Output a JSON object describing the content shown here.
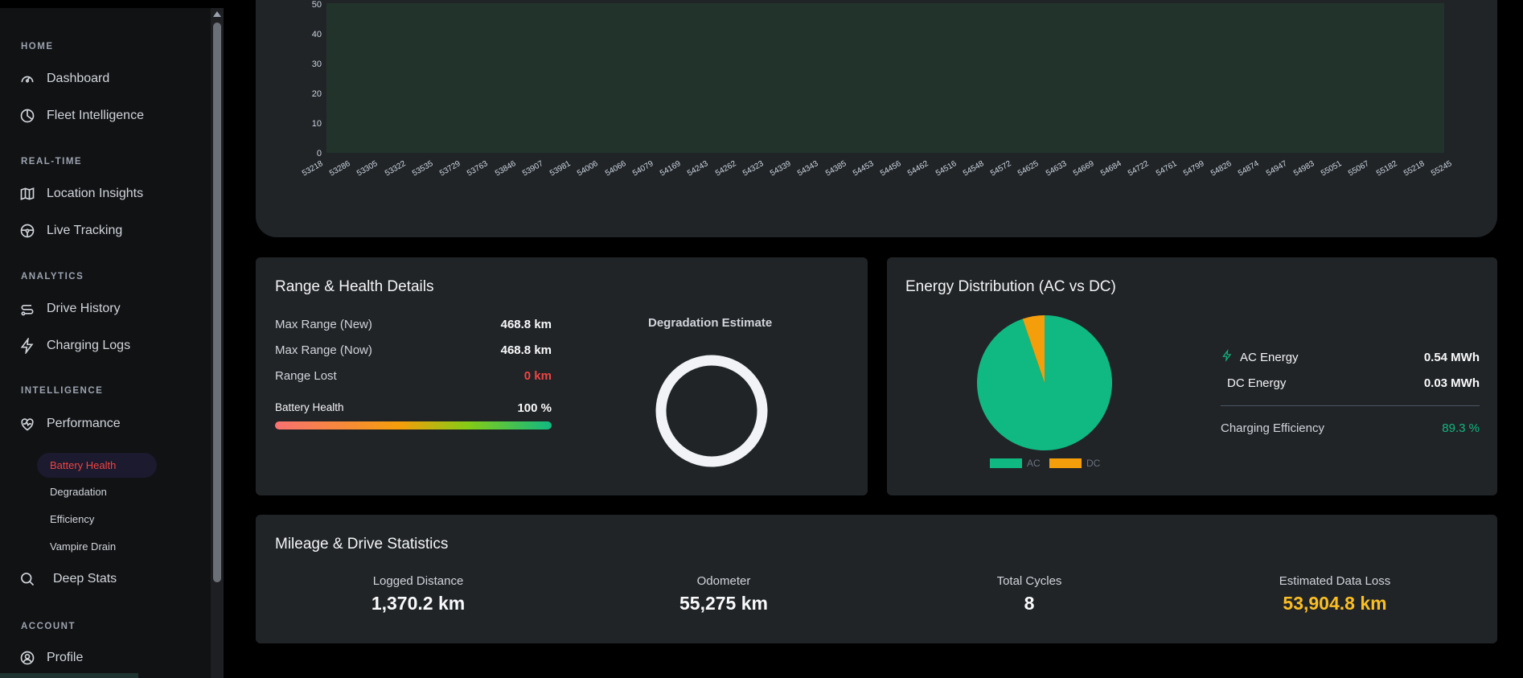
{
  "sidebar": {
    "sections": {
      "home": "HOME",
      "realtime": "REAL-TIME",
      "analytics": "ANALYTICS",
      "intelligence": "INTELLIGENCE",
      "account": "ACCOUNT"
    },
    "items": {
      "dashboard": "Dashboard",
      "fleet": "Fleet Intelligence",
      "location": "Location Insights",
      "live": "Live Tracking",
      "drive": "Drive History",
      "charging": "Charging Logs",
      "performance": "Performance",
      "deep": "Deep Stats",
      "profile": "Profile"
    },
    "sub_items": {
      "battery": "Battery Health",
      "degradation": "Degradation",
      "efficiency": "Efficiency",
      "vampire": "Vampire Drain"
    }
  },
  "top_chart": {
    "y_ticks": [
      "50",
      "40",
      "30",
      "20",
      "10",
      "0"
    ],
    "x_ticks": [
      "53218",
      "53286",
      "53305",
      "53322",
      "53535",
      "53729",
      "53763",
      "53846",
      "53907",
      "53981",
      "54006",
      "54066",
      "54079",
      "54169",
      "54243",
      "54262",
      "54323",
      "54339",
      "54343",
      "54385",
      "54453",
      "54456",
      "54462",
      "54516",
      "54548",
      "54572",
      "54625",
      "54633",
      "54669",
      "54684",
      "54722",
      "54761",
      "54799",
      "54826",
      "54874",
      "54947",
      "54983",
      "55051",
      "55067",
      "55182",
      "55218",
      "55245"
    ]
  },
  "range_health": {
    "title": "Range & Health Details",
    "max_range_new_label": "Max Range (New)",
    "max_range_new_value": "468.8 km",
    "max_range_now_label": "Max Range (Now)",
    "max_range_now_value": "468.8 km",
    "range_lost_label": "Range Lost",
    "range_lost_value": "0 km",
    "battery_health_label": "Battery Health",
    "battery_health_value": "100 %",
    "degradation_title": "Degradation Estimate"
  },
  "energy": {
    "title": "Energy Distribution (AC vs DC)",
    "ac_label": "AC Energy",
    "ac_value": "0.54 MWh",
    "dc_label": "DC Energy",
    "dc_value": "0.03 MWh",
    "efficiency_label": "Charging Efficiency",
    "efficiency_value": "89.3 %",
    "legend_ac": "AC",
    "legend_dc": "DC",
    "colors": {
      "ac": "#10b981",
      "dc": "#f59e0b"
    }
  },
  "mileage": {
    "title": "Mileage & Drive Statistics",
    "logged_label": "Logged Distance",
    "logged_value": "1,370.2 km",
    "odometer_label": "Odometer",
    "odometer_value": "55,275 km",
    "cycles_label": "Total Cycles",
    "cycles_value": "8",
    "loss_label": "Estimated Data Loss",
    "loss_value": "53,904.8 km"
  }
}
